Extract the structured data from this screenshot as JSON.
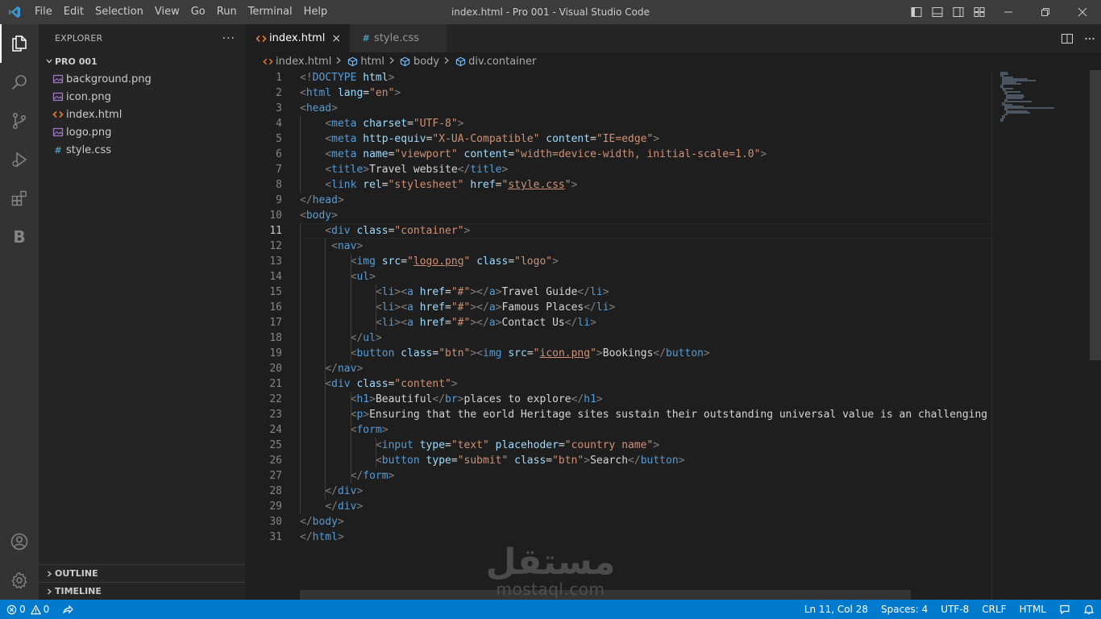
{
  "menu": [
    "File",
    "Edit",
    "Selection",
    "View",
    "Go",
    "Run",
    "Terminal",
    "Help"
  ],
  "window_title": "index.html - Pro 001 - Visual Studio Code",
  "explorer": {
    "title": "EXPLORER",
    "more": "···",
    "folder": "PRO 001",
    "files": [
      {
        "name": "background.png",
        "icon": "image-file-icon"
      },
      {
        "name": "icon.png",
        "icon": "image-file-icon"
      },
      {
        "name": "index.html",
        "icon": "html-file-icon"
      },
      {
        "name": "logo.png",
        "icon": "image-file-icon"
      },
      {
        "name": "style.css",
        "icon": "css-file-icon"
      }
    ],
    "outline": "OUTLINE",
    "timeline": "TIMELINE"
  },
  "tabs": [
    {
      "label": "index.html",
      "close": "×",
      "active": true
    },
    {
      "label": "style.css",
      "active": false
    }
  ],
  "breadcrumb": [
    "index.html",
    "html",
    "body",
    "div.container"
  ],
  "editor": {
    "current_line": 11,
    "lines": [
      [
        [
          "t-br",
          "<!"
        ],
        [
          "t-tag",
          "DOCTYPE"
        ],
        [
          "t-txt",
          " "
        ],
        [
          "t-attr",
          "html"
        ],
        [
          "t-br",
          ">"
        ]
      ],
      [
        [
          "t-br",
          "<"
        ],
        [
          "t-tag",
          "html"
        ],
        [
          "t-txt",
          " "
        ],
        [
          "t-attr",
          "lang"
        ],
        [
          "t-txt",
          "="
        ],
        [
          "t-str",
          "\"en\""
        ],
        [
          "t-br",
          ">"
        ]
      ],
      [
        [
          "t-br",
          "<"
        ],
        [
          "t-tag",
          "head"
        ],
        [
          "t-br",
          ">"
        ]
      ],
      [
        [
          "t-txt",
          "    "
        ],
        [
          "t-br",
          "<"
        ],
        [
          "t-tag",
          "meta"
        ],
        [
          "t-txt",
          " "
        ],
        [
          "t-attr",
          "charset"
        ],
        [
          "t-txt",
          "="
        ],
        [
          "t-str",
          "\"UTF-8\""
        ],
        [
          "t-br",
          ">"
        ]
      ],
      [
        [
          "t-txt",
          "    "
        ],
        [
          "t-br",
          "<"
        ],
        [
          "t-tag",
          "meta"
        ],
        [
          "t-txt",
          " "
        ],
        [
          "t-attr",
          "http-equiv"
        ],
        [
          "t-txt",
          "="
        ],
        [
          "t-str",
          "\"X-UA-Compatible\""
        ],
        [
          "t-txt",
          " "
        ],
        [
          "t-attr",
          "content"
        ],
        [
          "t-txt",
          "="
        ],
        [
          "t-str",
          "\"IE=edge\""
        ],
        [
          "t-br",
          ">"
        ]
      ],
      [
        [
          "t-txt",
          "    "
        ],
        [
          "t-br",
          "<"
        ],
        [
          "t-tag",
          "meta"
        ],
        [
          "t-txt",
          " "
        ],
        [
          "t-attr",
          "name"
        ],
        [
          "t-txt",
          "="
        ],
        [
          "t-str",
          "\"viewport\""
        ],
        [
          "t-txt",
          " "
        ],
        [
          "t-attr",
          "content"
        ],
        [
          "t-txt",
          "="
        ],
        [
          "t-str",
          "\"width=device-width, initial-scale=1.0\""
        ],
        [
          "t-br",
          ">"
        ]
      ],
      [
        [
          "t-txt",
          "    "
        ],
        [
          "t-br",
          "<"
        ],
        [
          "t-tag",
          "title"
        ],
        [
          "t-br",
          ">"
        ],
        [
          "t-txt",
          "Travel website"
        ],
        [
          "t-br",
          "</"
        ],
        [
          "t-tag",
          "title"
        ],
        [
          "t-br",
          ">"
        ]
      ],
      [
        [
          "t-txt",
          "    "
        ],
        [
          "t-br",
          "<"
        ],
        [
          "t-tag",
          "link"
        ],
        [
          "t-txt",
          " "
        ],
        [
          "t-attr",
          "rel"
        ],
        [
          "t-txt",
          "="
        ],
        [
          "t-str",
          "\"stylesheet\""
        ],
        [
          "t-txt",
          " "
        ],
        [
          "t-attr",
          "href"
        ],
        [
          "t-txt",
          "="
        ],
        [
          "t-str",
          "\""
        ],
        [
          "t-str t-link",
          "style.css"
        ],
        [
          "t-str",
          "\""
        ],
        [
          "t-br",
          ">"
        ]
      ],
      [
        [
          "t-br",
          "</"
        ],
        [
          "t-tag",
          "head"
        ],
        [
          "t-br",
          ">"
        ]
      ],
      [
        [
          "t-br",
          "<"
        ],
        [
          "t-tag",
          "body"
        ],
        [
          "t-br",
          ">"
        ]
      ],
      [
        [
          "t-txt",
          "    "
        ],
        [
          "t-br",
          "<"
        ],
        [
          "t-tag",
          "div"
        ],
        [
          "t-txt",
          " "
        ],
        [
          "t-attr",
          "class"
        ],
        [
          "t-txt",
          "="
        ],
        [
          "t-str",
          "\"container\""
        ],
        [
          "t-br",
          ">"
        ]
      ],
      [
        [
          "t-txt",
          "     "
        ],
        [
          "t-br",
          "<"
        ],
        [
          "t-tag",
          "nav"
        ],
        [
          "t-br",
          ">"
        ]
      ],
      [
        [
          "t-txt",
          "        "
        ],
        [
          "t-br",
          "<"
        ],
        [
          "t-tag",
          "img"
        ],
        [
          "t-txt",
          " "
        ],
        [
          "t-attr",
          "src"
        ],
        [
          "t-txt",
          "="
        ],
        [
          "t-str",
          "\""
        ],
        [
          "t-str t-link",
          "logo.png"
        ],
        [
          "t-str",
          "\""
        ],
        [
          "t-txt",
          " "
        ],
        [
          "t-attr",
          "class"
        ],
        [
          "t-txt",
          "="
        ],
        [
          "t-str",
          "\"logo\""
        ],
        [
          "t-br",
          ">"
        ]
      ],
      [
        [
          "t-txt",
          "        "
        ],
        [
          "t-br",
          "<"
        ],
        [
          "t-tag",
          "ul"
        ],
        [
          "t-br",
          ">"
        ]
      ],
      [
        [
          "t-txt",
          "            "
        ],
        [
          "t-br",
          "<"
        ],
        [
          "t-tag",
          "li"
        ],
        [
          "t-br",
          "><"
        ],
        [
          "t-tag",
          "a"
        ],
        [
          "t-txt",
          " "
        ],
        [
          "t-attr",
          "href"
        ],
        [
          "t-txt",
          "="
        ],
        [
          "t-str",
          "\"#\""
        ],
        [
          "t-br",
          "></"
        ],
        [
          "t-tag",
          "a"
        ],
        [
          "t-br",
          ">"
        ],
        [
          "t-txt",
          "Travel Guide"
        ],
        [
          "t-br",
          "</"
        ],
        [
          "t-tag",
          "li"
        ],
        [
          "t-br",
          ">"
        ]
      ],
      [
        [
          "t-txt",
          "            "
        ],
        [
          "t-br",
          "<"
        ],
        [
          "t-tag",
          "li"
        ],
        [
          "t-br",
          "><"
        ],
        [
          "t-tag",
          "a"
        ],
        [
          "t-txt",
          " "
        ],
        [
          "t-attr",
          "href"
        ],
        [
          "t-txt",
          "="
        ],
        [
          "t-str",
          "\"#\""
        ],
        [
          "t-br",
          "></"
        ],
        [
          "t-tag",
          "a"
        ],
        [
          "t-br",
          ">"
        ],
        [
          "t-txt",
          "Famous Places"
        ],
        [
          "t-br",
          "</"
        ],
        [
          "t-tag",
          "li"
        ],
        [
          "t-br",
          ">"
        ]
      ],
      [
        [
          "t-txt",
          "            "
        ],
        [
          "t-br",
          "<"
        ],
        [
          "t-tag",
          "li"
        ],
        [
          "t-br",
          "><"
        ],
        [
          "t-tag",
          "a"
        ],
        [
          "t-txt",
          " "
        ],
        [
          "t-attr",
          "href"
        ],
        [
          "t-txt",
          "="
        ],
        [
          "t-str",
          "\"#\""
        ],
        [
          "t-br",
          "></"
        ],
        [
          "t-tag",
          "a"
        ],
        [
          "t-br",
          ">"
        ],
        [
          "t-txt",
          "Contact Us"
        ],
        [
          "t-br",
          "</"
        ],
        [
          "t-tag",
          "li"
        ],
        [
          "t-br",
          ">"
        ]
      ],
      [
        [
          "t-txt",
          "        "
        ],
        [
          "t-br",
          "</"
        ],
        [
          "t-tag",
          "ul"
        ],
        [
          "t-br",
          ">"
        ]
      ],
      [
        [
          "t-txt",
          "        "
        ],
        [
          "t-br",
          "<"
        ],
        [
          "t-tag",
          "button"
        ],
        [
          "t-txt",
          " "
        ],
        [
          "t-attr",
          "class"
        ],
        [
          "t-txt",
          "="
        ],
        [
          "t-str",
          "\"btn\""
        ],
        [
          "t-br",
          "><"
        ],
        [
          "t-tag",
          "img"
        ],
        [
          "t-txt",
          " "
        ],
        [
          "t-attr",
          "src"
        ],
        [
          "t-txt",
          "="
        ],
        [
          "t-str",
          "\""
        ],
        [
          "t-str t-link",
          "icon.png"
        ],
        [
          "t-str",
          "\""
        ],
        [
          "t-br",
          ">"
        ],
        [
          "t-txt",
          "Bookings"
        ],
        [
          "t-br",
          "</"
        ],
        [
          "t-tag",
          "button"
        ],
        [
          "t-br",
          ">"
        ]
      ],
      [
        [
          "t-txt",
          "    "
        ],
        [
          "t-br",
          "</"
        ],
        [
          "t-tag",
          "nav"
        ],
        [
          "t-br",
          ">"
        ]
      ],
      [
        [
          "t-txt",
          "    "
        ],
        [
          "t-br",
          "<"
        ],
        [
          "t-tag",
          "div"
        ],
        [
          "t-txt",
          " "
        ],
        [
          "t-attr",
          "class"
        ],
        [
          "t-txt",
          "="
        ],
        [
          "t-str",
          "\"content\""
        ],
        [
          "t-br",
          ">"
        ]
      ],
      [
        [
          "t-txt",
          "        "
        ],
        [
          "t-br",
          "<"
        ],
        [
          "t-tag",
          "h1"
        ],
        [
          "t-br",
          ">"
        ],
        [
          "t-txt",
          "Beautiful"
        ],
        [
          "t-br",
          "</"
        ],
        [
          "t-tag",
          "br"
        ],
        [
          "t-br",
          ">"
        ],
        [
          "t-txt",
          "places to explore"
        ],
        [
          "t-br",
          "</"
        ],
        [
          "t-tag",
          "h1"
        ],
        [
          "t-br",
          ">"
        ]
      ],
      [
        [
          "t-txt",
          "        "
        ],
        [
          "t-br",
          "<"
        ],
        [
          "t-tag",
          "p"
        ],
        [
          "t-br",
          ">"
        ],
        [
          "t-txt",
          "Ensuring that the eorld Heritage sites sustain their outstanding universal value is an challenging mi"
        ]
      ],
      [
        [
          "t-txt",
          "        "
        ],
        [
          "t-br",
          "<"
        ],
        [
          "t-tag",
          "form"
        ],
        [
          "t-br",
          ">"
        ]
      ],
      [
        [
          "t-txt",
          "            "
        ],
        [
          "t-br",
          "<"
        ],
        [
          "t-tag",
          "input"
        ],
        [
          "t-txt",
          " "
        ],
        [
          "t-attr",
          "type"
        ],
        [
          "t-txt",
          "="
        ],
        [
          "t-str",
          "\"text\""
        ],
        [
          "t-txt",
          " "
        ],
        [
          "t-attr",
          "placehoder"
        ],
        [
          "t-txt",
          "="
        ],
        [
          "t-str",
          "\"country name\""
        ],
        [
          "t-br",
          ">"
        ]
      ],
      [
        [
          "t-txt",
          "            "
        ],
        [
          "t-br",
          "<"
        ],
        [
          "t-tag",
          "button"
        ],
        [
          "t-txt",
          " "
        ],
        [
          "t-attr",
          "type"
        ],
        [
          "t-txt",
          "="
        ],
        [
          "t-str",
          "\"submit\""
        ],
        [
          "t-txt",
          " "
        ],
        [
          "t-attr",
          "class"
        ],
        [
          "t-txt",
          "="
        ],
        [
          "t-str",
          "\"btn\""
        ],
        [
          "t-br",
          ">"
        ],
        [
          "t-txt",
          "Search"
        ],
        [
          "t-br",
          "</"
        ],
        [
          "t-tag",
          "button"
        ],
        [
          "t-br",
          ">"
        ]
      ],
      [
        [
          "t-txt",
          "        "
        ],
        [
          "t-br",
          "</"
        ],
        [
          "t-tag",
          "form"
        ],
        [
          "t-br",
          ">"
        ]
      ],
      [
        [
          "t-txt",
          "    "
        ],
        [
          "t-br",
          "</"
        ],
        [
          "t-tag",
          "div"
        ],
        [
          "t-br",
          ">"
        ]
      ],
      [
        [
          "t-txt",
          "    "
        ],
        [
          "t-br",
          "</"
        ],
        [
          "t-tag",
          "div"
        ],
        [
          "t-br",
          ">"
        ]
      ],
      [
        [
          "t-br",
          "</"
        ],
        [
          "t-tag",
          "body"
        ],
        [
          "t-br",
          ">"
        ]
      ],
      [
        [
          "t-br",
          "</"
        ],
        [
          "t-tag",
          "html"
        ],
        [
          "t-br",
          ">"
        ]
      ]
    ]
  },
  "watermark": {
    "arabic": "مستقل",
    "latin": "mostaql.com"
  },
  "status": {
    "errors": "0",
    "warnings": "0",
    "position": "Ln 11, Col 28",
    "spaces": "Spaces: 4",
    "encoding": "UTF-8",
    "eol": "CRLF",
    "language": "HTML"
  },
  "colors": {
    "accent": "#007acc",
    "titlebar": "#3c3c3c",
    "activitybar": "#333333",
    "sidebar": "#252526",
    "editor": "#1e1e1e",
    "html_icon": "#e37933",
    "css_icon": "#519aba",
    "image_icon": "#a074c4"
  }
}
